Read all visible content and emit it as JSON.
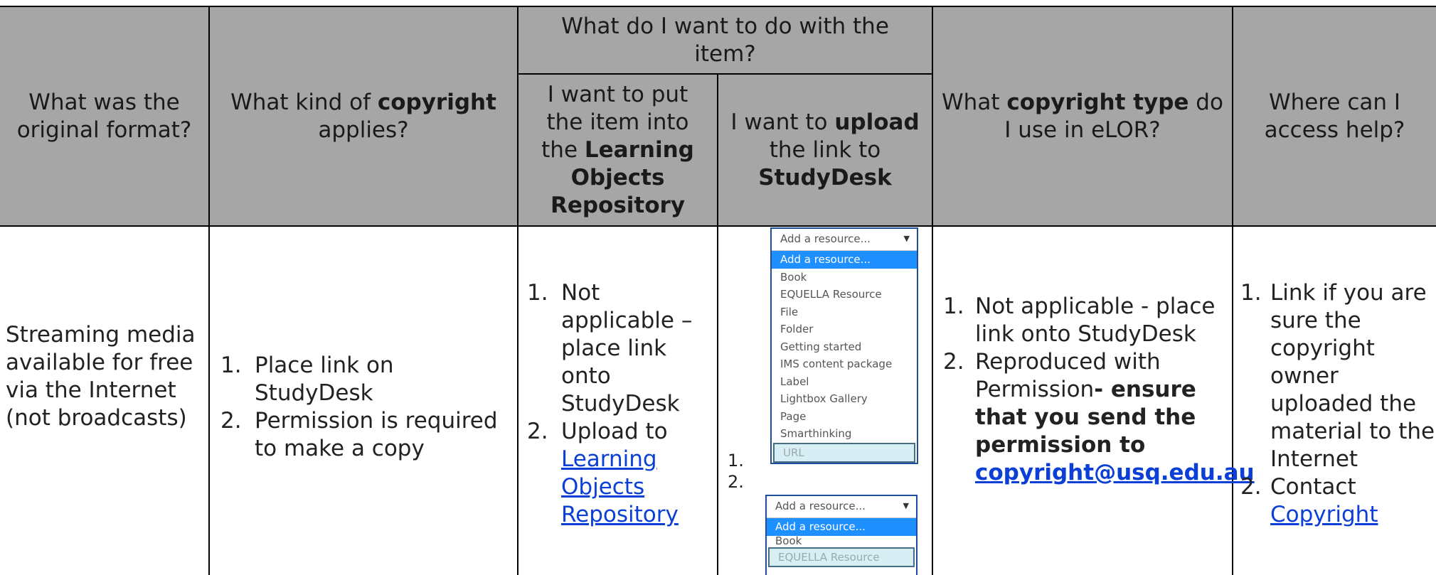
{
  "headers": {
    "original_format": "What was the original format?",
    "copyright_kind_pre": "What kind of ",
    "copyright_kind_bold": "copyright",
    "copyright_kind_post": " applies?",
    "want_to_do": "What do I want to do with the item?",
    "put_pre": "I want to put the item into the ",
    "put_bold": "Learning Objects Repository",
    "upload_pre": "I want to ",
    "upload_bold": "upload",
    "upload_mid": " the link to ",
    "upload_bold2": "StudyDesk",
    "type_pre": "What ",
    "type_bold": "copyright type",
    "type_post": " do I use in eLOR?",
    "help": "Where can I access help?"
  },
  "row": {
    "format": "Streaming media available for free via the Internet (not broadcasts)",
    "copyright_items": [
      "Place link on StudyDesk",
      "Permission is required to make a copy"
    ],
    "repo_item1": "Not applicable – place link onto StudyDesk",
    "repo_item2_pre": "Upload to ",
    "repo_item2_link": "Learning Objects Repository",
    "upload_nums": [
      "1.",
      "2."
    ],
    "type_item1": "Not applicable - place link onto StudyDesk",
    "type_item2_pre": "Reproduced with Permission",
    "type_item2_bold": "- ensure that you send the permission to ",
    "type_item2_link": "copyright@usq.edu.au",
    "help_item1": "Link if you are sure the copyright owner uploaded the material to the Internet",
    "help_item2_pre": "Contact ",
    "help_item2_link": "Copyright"
  },
  "dropdown1": {
    "selected": "Add a resource...",
    "options": [
      "Add a resource...",
      "Book",
      "EQUELLA Resource",
      "File",
      "Folder",
      "Getting started",
      "IMS content package",
      "Label",
      "Lightbox Gallery",
      "Page",
      "Smarthinking",
      "URL"
    ]
  },
  "dropdown2": {
    "selected": "Add a resource...",
    "options": [
      "Add a resource...",
      "Book",
      "EQUELLA Resource"
    ]
  },
  "colors": {
    "header_bg": "#a6a6a6",
    "link": "#0b3fd6",
    "highlight": "#1e90ff"
  }
}
